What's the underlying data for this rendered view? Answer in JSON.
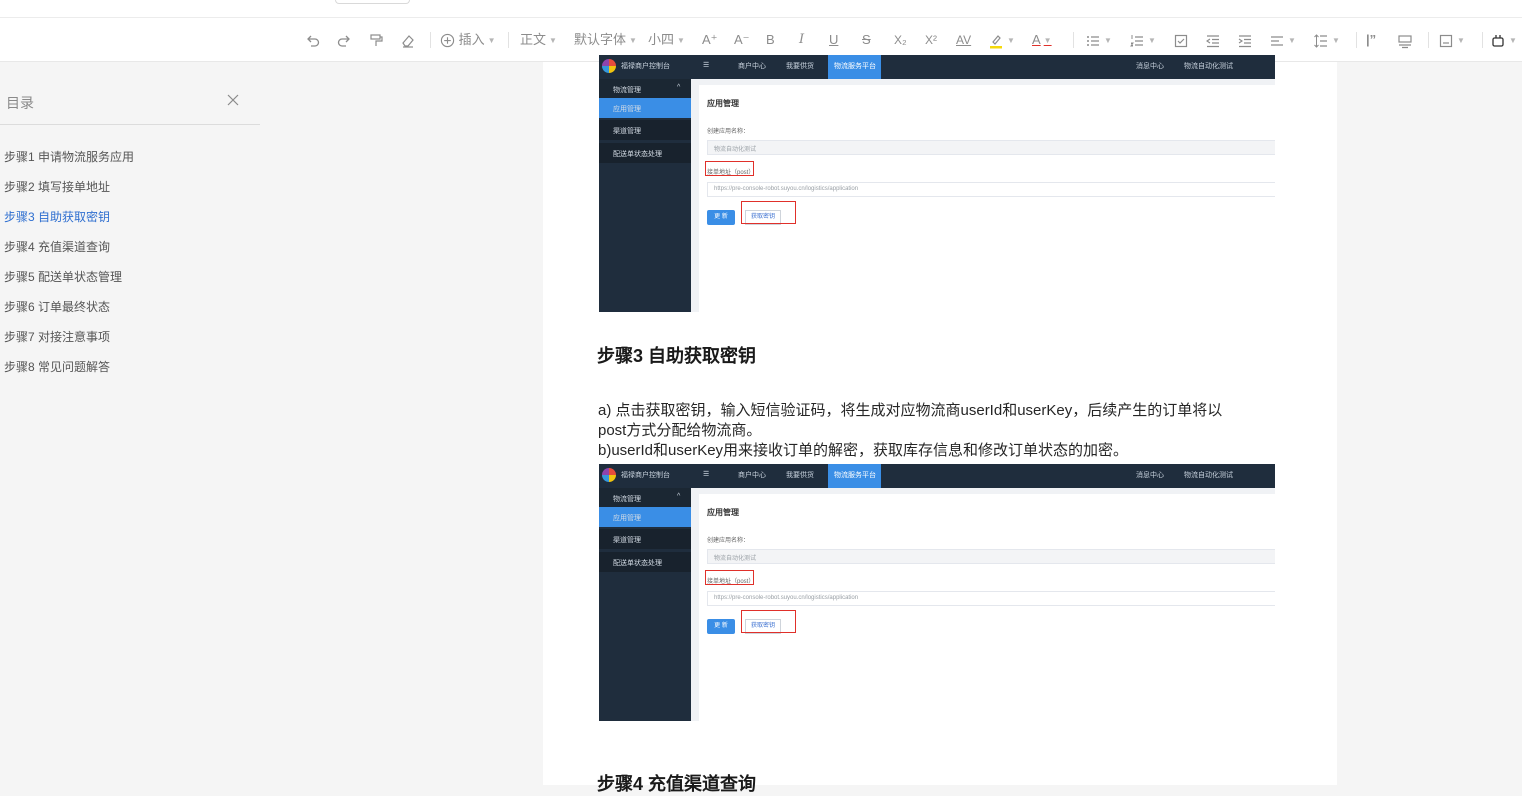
{
  "toolbar": {
    "undo_icon": "undo-icon",
    "redo_icon": "redo-icon",
    "insert_label": "插入",
    "style_label": "正文",
    "font_label": "默认字体",
    "size_label": "小四",
    "bold": "B",
    "italic": "I",
    "underline": "U",
    "strike": "S",
    "sub": "X₂",
    "sup": "X²",
    "spacing": "AV",
    "font_color": "A",
    "grow": "A⁺",
    "shrink": "A⁻"
  },
  "toc": {
    "title": "目录",
    "items": [
      {
        "label": "步骤1  申请物流服务应用"
      },
      {
        "label": "步骤2  填写接单地址"
      },
      {
        "label": "步骤3  自助获取密钥"
      },
      {
        "label": "步骤4  充值渠道查询"
      },
      {
        "label": "步骤5  配送单状态管理"
      },
      {
        "label": "步骤6  订单最终状态"
      },
      {
        "label": "步骤7  对接注意事项"
      },
      {
        "label": "步骤8  常见问题解答"
      }
    ],
    "active_index": 2,
    "active_color": "#2f6fd0"
  },
  "screenshot": {
    "brand": "福禄商户控制台",
    "nav_items": [
      "商户中心",
      "我要供货"
    ],
    "nav_active": "物流服务平台",
    "nav_right": [
      "消息中心",
      "物流自动化测试"
    ],
    "side_group": "物流管理",
    "side_items": [
      "应用管理",
      "渠道管理",
      "配送单状态处理"
    ],
    "page_heading": "应用管理",
    "app_name_label": "创建应用名称：",
    "app_name_value": "物流自动化测试",
    "url_label": "接单地址（post）",
    "url_value": "https://pre-console-robot.suyou.cn/logistics/application",
    "btn_update": "更 新",
    "btn_get_key": "获取密钥"
  },
  "doc": {
    "heading3": "步骤3  自助获取密钥",
    "para_a_1": "a) 点击获取密钥，输入短信验证码，将生成对应物流商userId和userKey，后续产生的订单将以",
    "para_a_2": "post方式分配给物流商。",
    "para_b": "b)userId和userKey用来接收订单的解密，获取库存信息和修改订单状态的加密。",
    "heading4": "步骤4  充值渠道查询"
  }
}
